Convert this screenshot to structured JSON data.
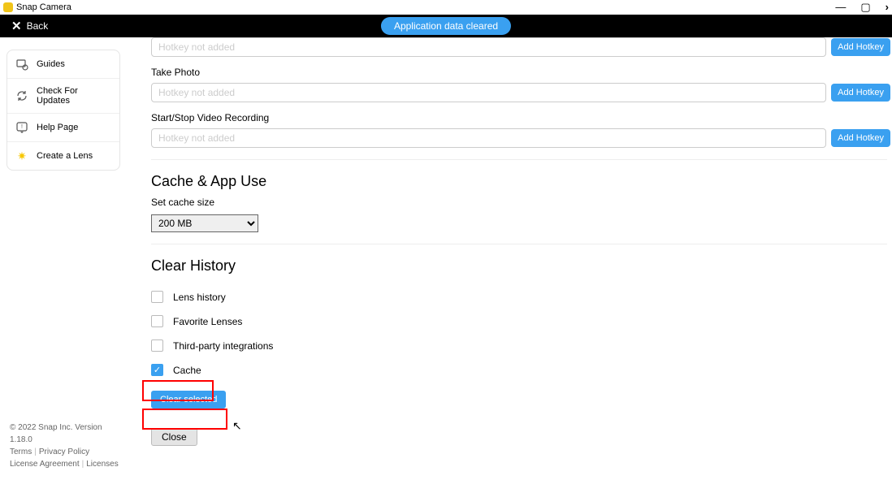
{
  "window": {
    "title": "Snap Camera"
  },
  "header": {
    "back": "Back",
    "banner": "Application data cleared"
  },
  "sidebar": {
    "items": [
      {
        "label": "Guides"
      },
      {
        "label": "Check For Updates"
      },
      {
        "label": "Help Page"
      },
      {
        "label": "Create a Lens"
      }
    ]
  },
  "hotkeys": {
    "placeholder": "Hotkey not added",
    "add_label": "Add Hotkey",
    "rows": [
      {
        "label": ""
      },
      {
        "label": "Take Photo"
      },
      {
        "label": "Start/Stop Video Recording"
      }
    ]
  },
  "cache": {
    "heading": "Cache & App Use",
    "size_label": "Set cache size",
    "size_value": "200 MB"
  },
  "history": {
    "heading": "Clear History",
    "options": [
      {
        "label": "Lens history",
        "checked": false
      },
      {
        "label": "Favorite Lenses",
        "checked": false
      },
      {
        "label": "Third-party integrations",
        "checked": false
      },
      {
        "label": "Cache",
        "checked": true
      }
    ],
    "clear_btn": "Clear selected",
    "close_btn": "Close"
  },
  "footer": {
    "copyright": "© 2022 Snap Inc. Version 1.18.0",
    "links": [
      "Terms",
      "Privacy Policy",
      "License Agreement",
      "Licenses"
    ]
  }
}
